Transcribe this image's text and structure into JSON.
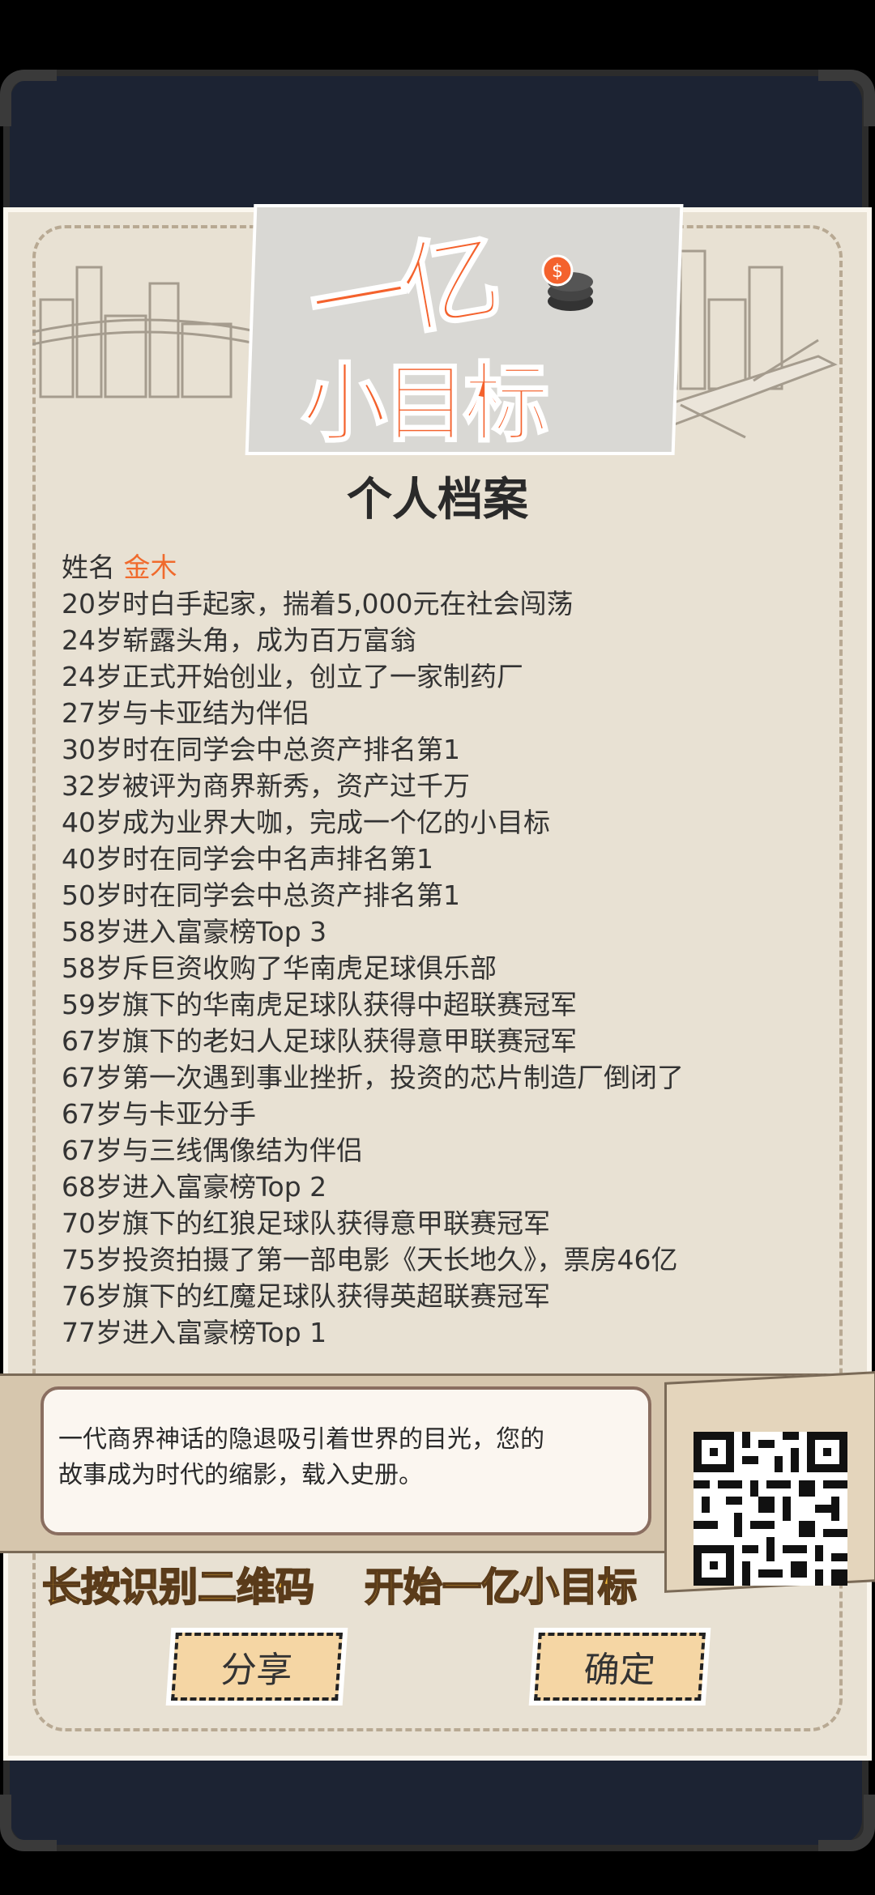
{
  "logo": {
    "line1": "一亿",
    "line2": "小目标"
  },
  "title": "个人档案",
  "profile": {
    "name_label": "姓名",
    "name_value": "金木"
  },
  "events": [
    "20岁时白手起家，揣着5,000元在社会闯荡",
    "24岁崭露头角，成为百万富翁",
    "24岁正式开始创业，创立了一家制药厂",
    "27岁与卡亚结为伴侣",
    "30岁时在同学会中总资产排名第1",
    "32岁被评为商界新秀，资产过千万",
    "40岁成为业界大咖，完成一个亿的小目标",
    "40岁时在同学会中名声排名第1",
    "50岁时在同学会中总资产排名第1",
    "58岁进入富豪榜Top 3",
    "58岁斥巨资收购了华南虎足球俱乐部",
    "59岁旗下的华南虎足球队获得中超联赛冠军",
    "67岁旗下的老妇人足球队获得意甲联赛冠军",
    "67岁第一次遇到事业挫折，投资的芯片制造厂倒闭了",
    "67岁与卡亚分手",
    "67岁与三线偶像结为伴侣",
    "68岁进入富豪榜Top 2",
    "70岁旗下的红狼足球队获得意甲联赛冠军",
    "75岁投资拍摄了第一部电影《天长地久》，票房46亿",
    "76岁旗下的红魔足球队获得英超联赛冠军",
    "77岁进入富豪榜Top 1"
  ],
  "quote": {
    "line1": "一代商界神话的隐退吸引着世界的目光，您的",
    "line2": "故事成为时代的缩影，载入史册。"
  },
  "cta": {
    "left": "长按识别二维码",
    "right": "开始一亿小目标"
  },
  "buttons": {
    "share": "分享",
    "confirm": "确定"
  }
}
